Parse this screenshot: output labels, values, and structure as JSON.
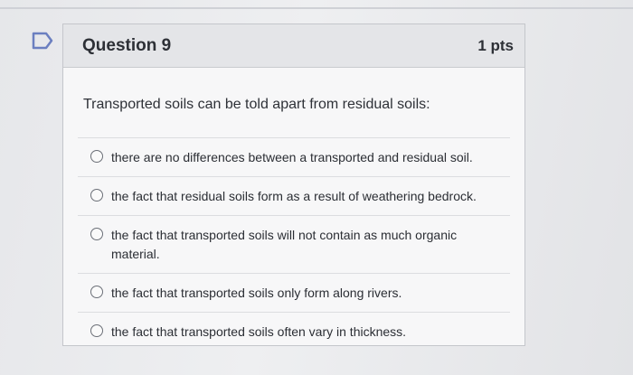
{
  "question": {
    "title": "Question 9",
    "points": "1 pts",
    "prompt": "Transported soils can be told apart from residual soils:",
    "answers": [
      {
        "label": "there are no differences between a transported and residual soil."
      },
      {
        "label": "the fact that residual soils form as a result of weathering bedrock."
      },
      {
        "label": "the fact that transported soils will not contain as much organic material."
      },
      {
        "label": "the fact that transported soils only form along rivers."
      },
      {
        "label": "the fact that transported soils often vary in thickness."
      }
    ]
  },
  "icons": {
    "flag": "flag-icon",
    "radio": "radio-button-icon"
  },
  "colors": {
    "header_bg": "#e4e5e8",
    "card_bg": "#f7f7f8",
    "text": "#2d3036",
    "flag": "#6b7fc0"
  }
}
